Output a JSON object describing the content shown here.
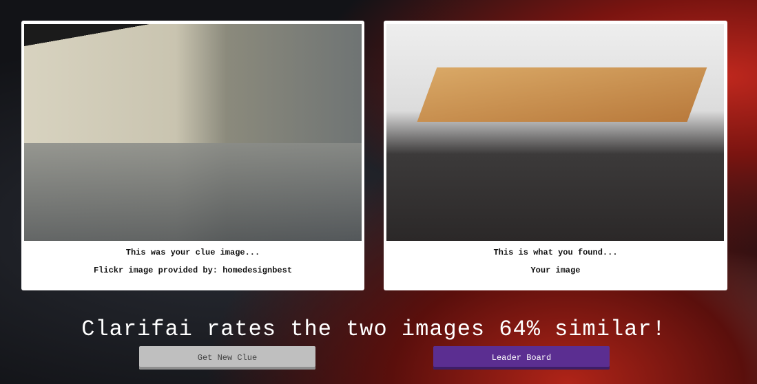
{
  "clue_card": {
    "caption": "This was your clue image...",
    "credit": "Flickr image provided by: homedesignbest"
  },
  "found_card": {
    "caption": "This is what you found...",
    "credit": "Your image"
  },
  "result": {
    "text": "Clarifai rates the two images 64% similar!",
    "similarity_percent": 64
  },
  "buttons": {
    "new_clue": "Get New Clue",
    "leader_board": "Leader Board"
  },
  "colors": {
    "leader_board": "#5b2e91",
    "new_clue": "#bfbfbf"
  }
}
